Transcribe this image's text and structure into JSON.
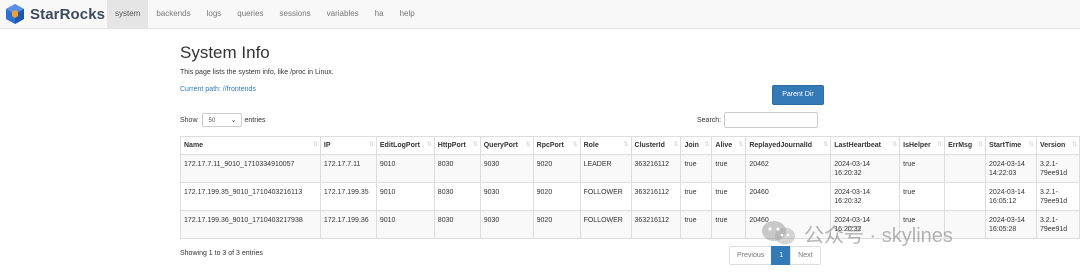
{
  "brand": {
    "name": "StarRocks",
    "logo_icon": "starrocks-logo-icon",
    "colors": {
      "blue": "#2f6fd1",
      "orange": "#f0a030",
      "dark": "#3d4a5c"
    }
  },
  "nav": {
    "items": [
      {
        "label": "system",
        "active": true
      },
      {
        "label": "backends"
      },
      {
        "label": "logs"
      },
      {
        "label": "queries"
      },
      {
        "label": "sessions"
      },
      {
        "label": "variables"
      },
      {
        "label": "ha"
      },
      {
        "label": "help"
      }
    ]
  },
  "page": {
    "title": "System Info",
    "description": "This page lists the system info, like /proc in Linux.",
    "current_path": "Current path: //frontends",
    "parent_button": "Parent Dir"
  },
  "controls": {
    "show_label": "Show",
    "entries_value": "50",
    "entries_label": "entries",
    "search_label": "Search:",
    "search_value": ""
  },
  "table": {
    "columns": [
      "Name",
      "IP",
      "EditLogPort",
      "HttpPort",
      "QueryPort",
      "RpcPort",
      "Role",
      "ClusterId",
      "Join",
      "Alive",
      "ReplayedJournalId",
      "LastHeartbeat",
      "IsHelper",
      "ErrMsg",
      "StartTime",
      "Version"
    ],
    "rows": [
      [
        "172.17.7.11_9010_1710334910057",
        "172.17.7.11",
        "9010",
        "8030",
        "9030",
        "9020",
        "LEADER",
        "363216112",
        "true",
        "true",
        "20462",
        "2024-03-14 16:20:32",
        "true",
        "",
        "2024-03-14 14:22:03",
        "3.2.1-79ee91d"
      ],
      [
        "172.17.199.35_9010_1710403216113",
        "172.17.199.35",
        "9010",
        "8030",
        "9030",
        "9020",
        "FOLLOWER",
        "363216112",
        "true",
        "true",
        "20460",
        "2024-03-14 16:20:32",
        "true",
        "",
        "2024-03-14 16:05:12",
        "3.2.1-79ee91d"
      ],
      [
        "172.17.199.36_9010_1710403217938",
        "172.17.199.36",
        "9010",
        "8030",
        "9030",
        "9020",
        "FOLLOWER",
        "363216112",
        "true",
        "true",
        "20460",
        "2024-03-14 16:20:32",
        "true",
        "",
        "2024-03-14 16:05:28",
        "3.2.1-79ee91d"
      ]
    ]
  },
  "footer": {
    "info": "Showing 1 to 3 of 3 entries",
    "pagination": {
      "previous": "Previous",
      "page": "1",
      "next": "Next"
    }
  },
  "watermark": {
    "text": "公众号 · skylines",
    "icon": "wechat-icon"
  }
}
